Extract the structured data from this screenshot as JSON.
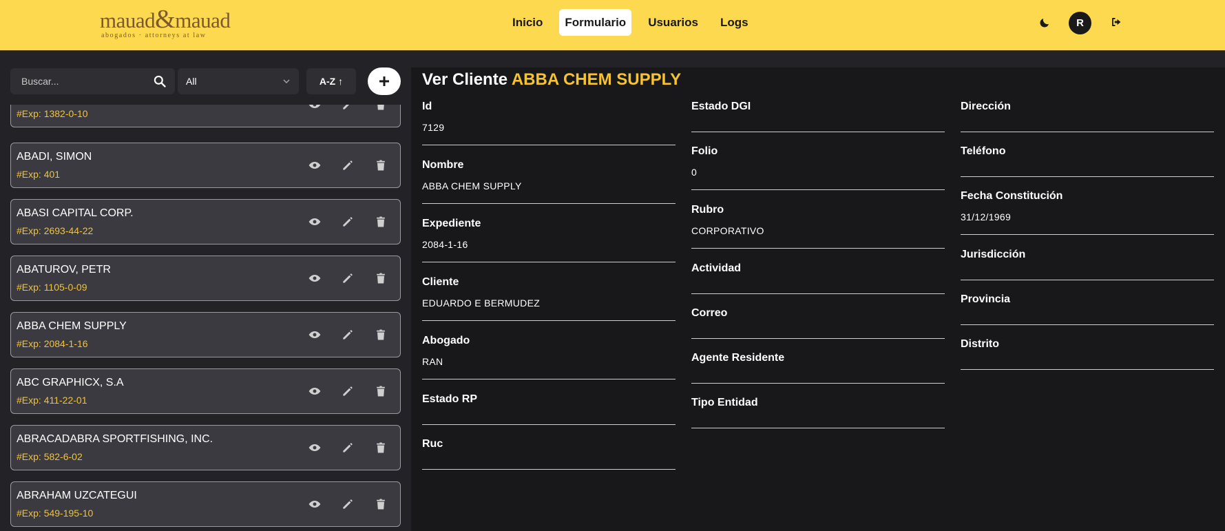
{
  "header": {
    "logo_main_left": "mauad",
    "logo_amp": "&",
    "logo_main_right": "mauad",
    "logo_sub": "abogados · attorneys at law",
    "nav": [
      "Inicio",
      "Formulario",
      "Usuarios",
      "Logs"
    ],
    "active_nav": "Formulario",
    "avatar_initial": "R",
    "icons": [
      "moon-icon",
      "logout-icon"
    ]
  },
  "toolbar": {
    "search_placeholder": "Buscar...",
    "search_value": "",
    "filter_value": "All",
    "sort_label": "A-Z ↑",
    "add_icon": "plus-icon"
  },
  "clients": [
    {
      "name": "",
      "exp": "#Exp: 1382-0-10"
    },
    {
      "name": "ABADI, SIMON",
      "exp": "#Exp: 401"
    },
    {
      "name": "ABASI CAPITAL CORP.",
      "exp": "#Exp: 2693-44-22"
    },
    {
      "name": "ABATUROV, PETR",
      "exp": "#Exp: 1105-0-09"
    },
    {
      "name": "ABBA CHEM SUPPLY",
      "exp": "#Exp: 2084-1-16"
    },
    {
      "name": "ABC GRAPHICX, S.A",
      "exp": "#Exp: 411-22-01"
    },
    {
      "name": "ABRACADABRA SPORTFISHING, INC.",
      "exp": "#Exp: 582-6-02"
    },
    {
      "name": "ABRAHAM UZCATEGUI",
      "exp": "#Exp: 549-195-10"
    }
  ],
  "detail": {
    "title_prefix": "Ver Cliente",
    "title_name": "ABBA CHEM SUPPLY",
    "col1": [
      {
        "label": "Id",
        "value": "7129"
      },
      {
        "label": "Nombre",
        "value": "ABBA CHEM SUPPLY"
      },
      {
        "label": "Expediente",
        "value": "2084-1-16"
      },
      {
        "label": "Cliente",
        "value": "EDUARDO E BERMUDEZ"
      },
      {
        "label": "Abogado",
        "value": "RAN"
      },
      {
        "label": "Estado RP",
        "value": ""
      },
      {
        "label": "Ruc",
        "value": ""
      }
    ],
    "col2": [
      {
        "label": "Estado DGI",
        "value": ""
      },
      {
        "label": "Folio",
        "value": "0"
      },
      {
        "label": "Rubro",
        "value": "CORPORATIVO"
      },
      {
        "label": "Actividad",
        "value": ""
      },
      {
        "label": "Correo",
        "value": ""
      },
      {
        "label": "Agente Residente",
        "value": ""
      },
      {
        "label": "Tipo Entidad",
        "value": ""
      }
    ],
    "col3": [
      {
        "label": "Dirección",
        "value": ""
      },
      {
        "label": "Teléfono",
        "value": ""
      },
      {
        "label": "Fecha Constitución",
        "value": "31/12/1969"
      },
      {
        "label": "Jurisdicción",
        "value": ""
      },
      {
        "label": "Provincia",
        "value": ""
      },
      {
        "label": "Distrito",
        "value": ""
      }
    ]
  }
}
